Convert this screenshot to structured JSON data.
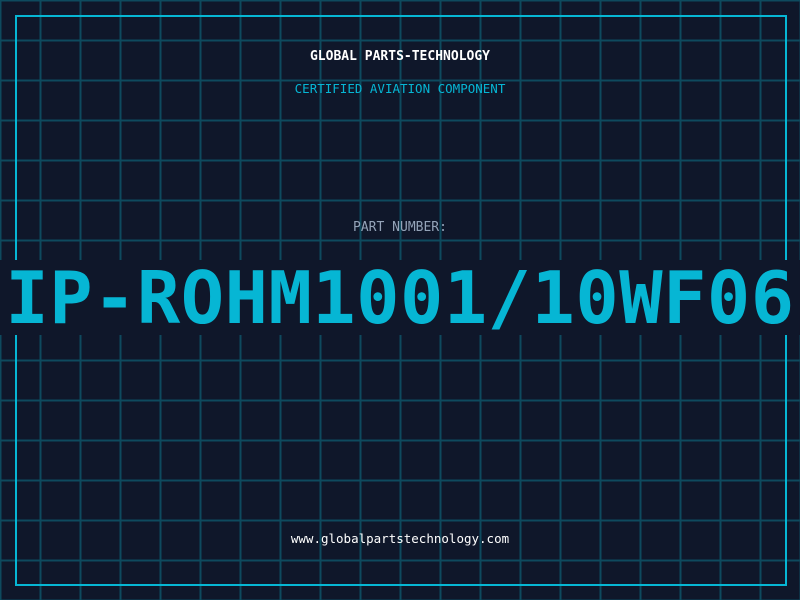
{
  "header": {
    "company": "GLOBAL PARTS-TECHNOLOGY",
    "subtitle": "CERTIFIED AVIATION COMPONENT"
  },
  "part": {
    "label": "PART NUMBER:",
    "number": "IP-ROHM1001/10WF06"
  },
  "footer": {
    "url": "www.globalpartstechnology.com"
  },
  "colors": {
    "background": "#0f172a",
    "accent": "#06b6d4",
    "grid": "#0e4a5e",
    "label": "#94a3b8"
  }
}
